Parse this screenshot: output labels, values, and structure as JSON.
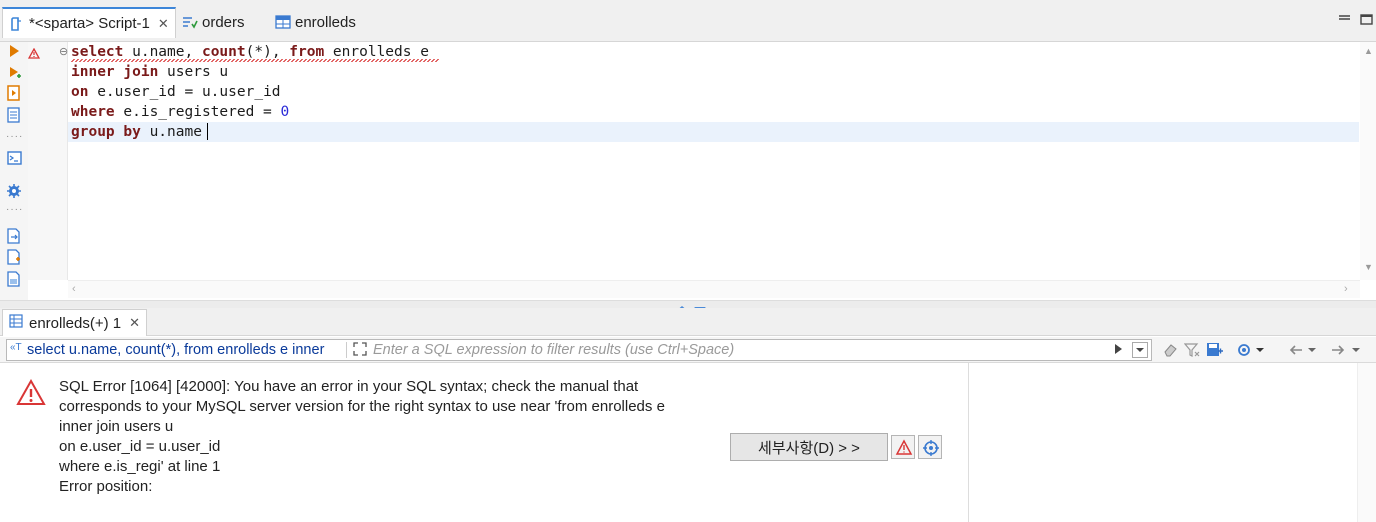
{
  "tabs": [
    {
      "label": "*<sparta> Script-1",
      "icon": "sql-script-icon",
      "active": true
    },
    {
      "label": "orders",
      "icon": "table-check-icon",
      "active": false
    },
    {
      "label": "enrolleds",
      "icon": "table-icon",
      "active": false
    }
  ],
  "editor": {
    "lines": [
      [
        {
          "t": "select",
          "k": "kw"
        },
        {
          "t": " u.name, ",
          "k": "plain"
        },
        {
          "t": "count",
          "k": "kw"
        },
        {
          "t": "(*), ",
          "k": "plain"
        },
        {
          "t": "from",
          "k": "kw"
        },
        {
          "t": " enrolleds e",
          "k": "plain"
        }
      ],
      [
        {
          "t": "inner join",
          "k": "kw"
        },
        {
          "t": " users u",
          "k": "plain"
        }
      ],
      [
        {
          "t": "on",
          "k": "kw"
        },
        {
          "t": " e.user_id = u.user_id",
          "k": "plain"
        }
      ],
      [
        {
          "t": "where",
          "k": "kw"
        },
        {
          "t": " e.is_registered = ",
          "k": "plain"
        },
        {
          "t": "0",
          "k": "num"
        }
      ],
      [
        {
          "t": "group by",
          "k": "kw"
        },
        {
          "t": " u.name",
          "k": "plain"
        }
      ]
    ]
  },
  "results": {
    "tab_label": "enrolleds(+) 1",
    "filter_query": "select u.name, count(*), from enrolleds e inner",
    "filter_placeholder": "Enter a SQL expression to filter results (use Ctrl+Space)",
    "error_lines": [
      "SQL Error [1064] [42000]: You have an error in your SQL syntax; check the manual that",
      "corresponds to your MySQL server version for the right syntax to use near 'from enrolleds e",
      "inner join users u",
      "on e.user_id = u.user_id",
      "where e.is_regi' at line 1",
      "Error position:"
    ],
    "details_button": "세부사항(D) > >"
  },
  "colors": {
    "accent": "#3d86d9",
    "keyword": "#7a1a1a",
    "error": "#d93636",
    "query_link": "#0a3a9a"
  }
}
